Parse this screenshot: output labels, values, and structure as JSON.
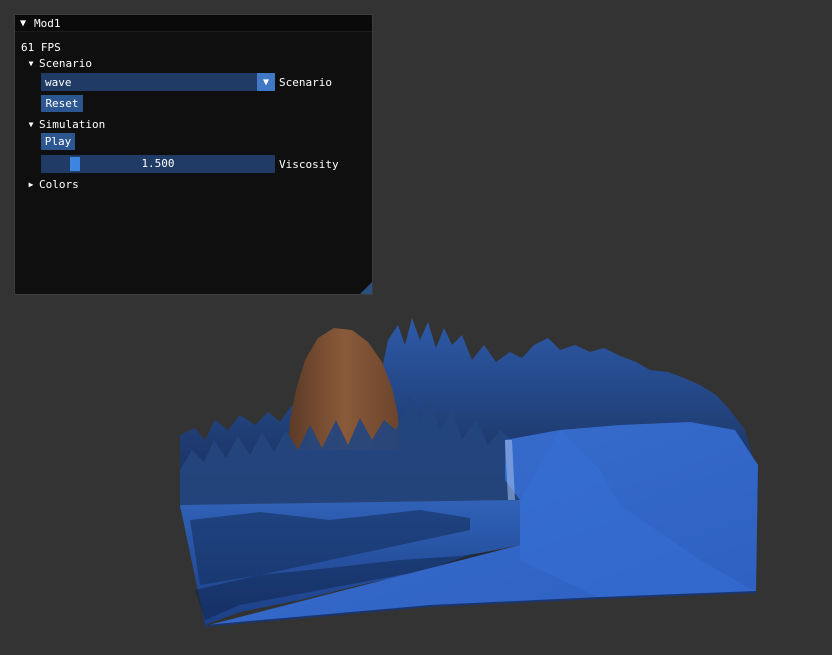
{
  "window": {
    "title": "Mod1",
    "fps": "61 FPS"
  },
  "scenario": {
    "header": "Scenario",
    "selected": "wave",
    "label": "Scenario",
    "reset_label": "Reset"
  },
  "simulation": {
    "header": "Simulation",
    "play_label": "Play",
    "viscosity_value": "1.500",
    "viscosity_label": "Viscosity",
    "viscosity_fraction": 0.13
  },
  "colors": {
    "header": "Colors"
  },
  "icons": {
    "window_collapse": "triangle-down-icon",
    "tree_expanded": "triangle-down-icon",
    "tree_collapsed": "triangle-right-icon",
    "combo_arrow": "chevron-down-icon",
    "resize": "resize-grip-icon"
  },
  "palette": {
    "background": "#333333",
    "window_bg": "#0f0f0f",
    "frame_bg": "#1f3b66",
    "button": "#2c568f",
    "accent": "#3d85e0",
    "water": "#2f63c4",
    "terrain": "#7a4e33"
  }
}
